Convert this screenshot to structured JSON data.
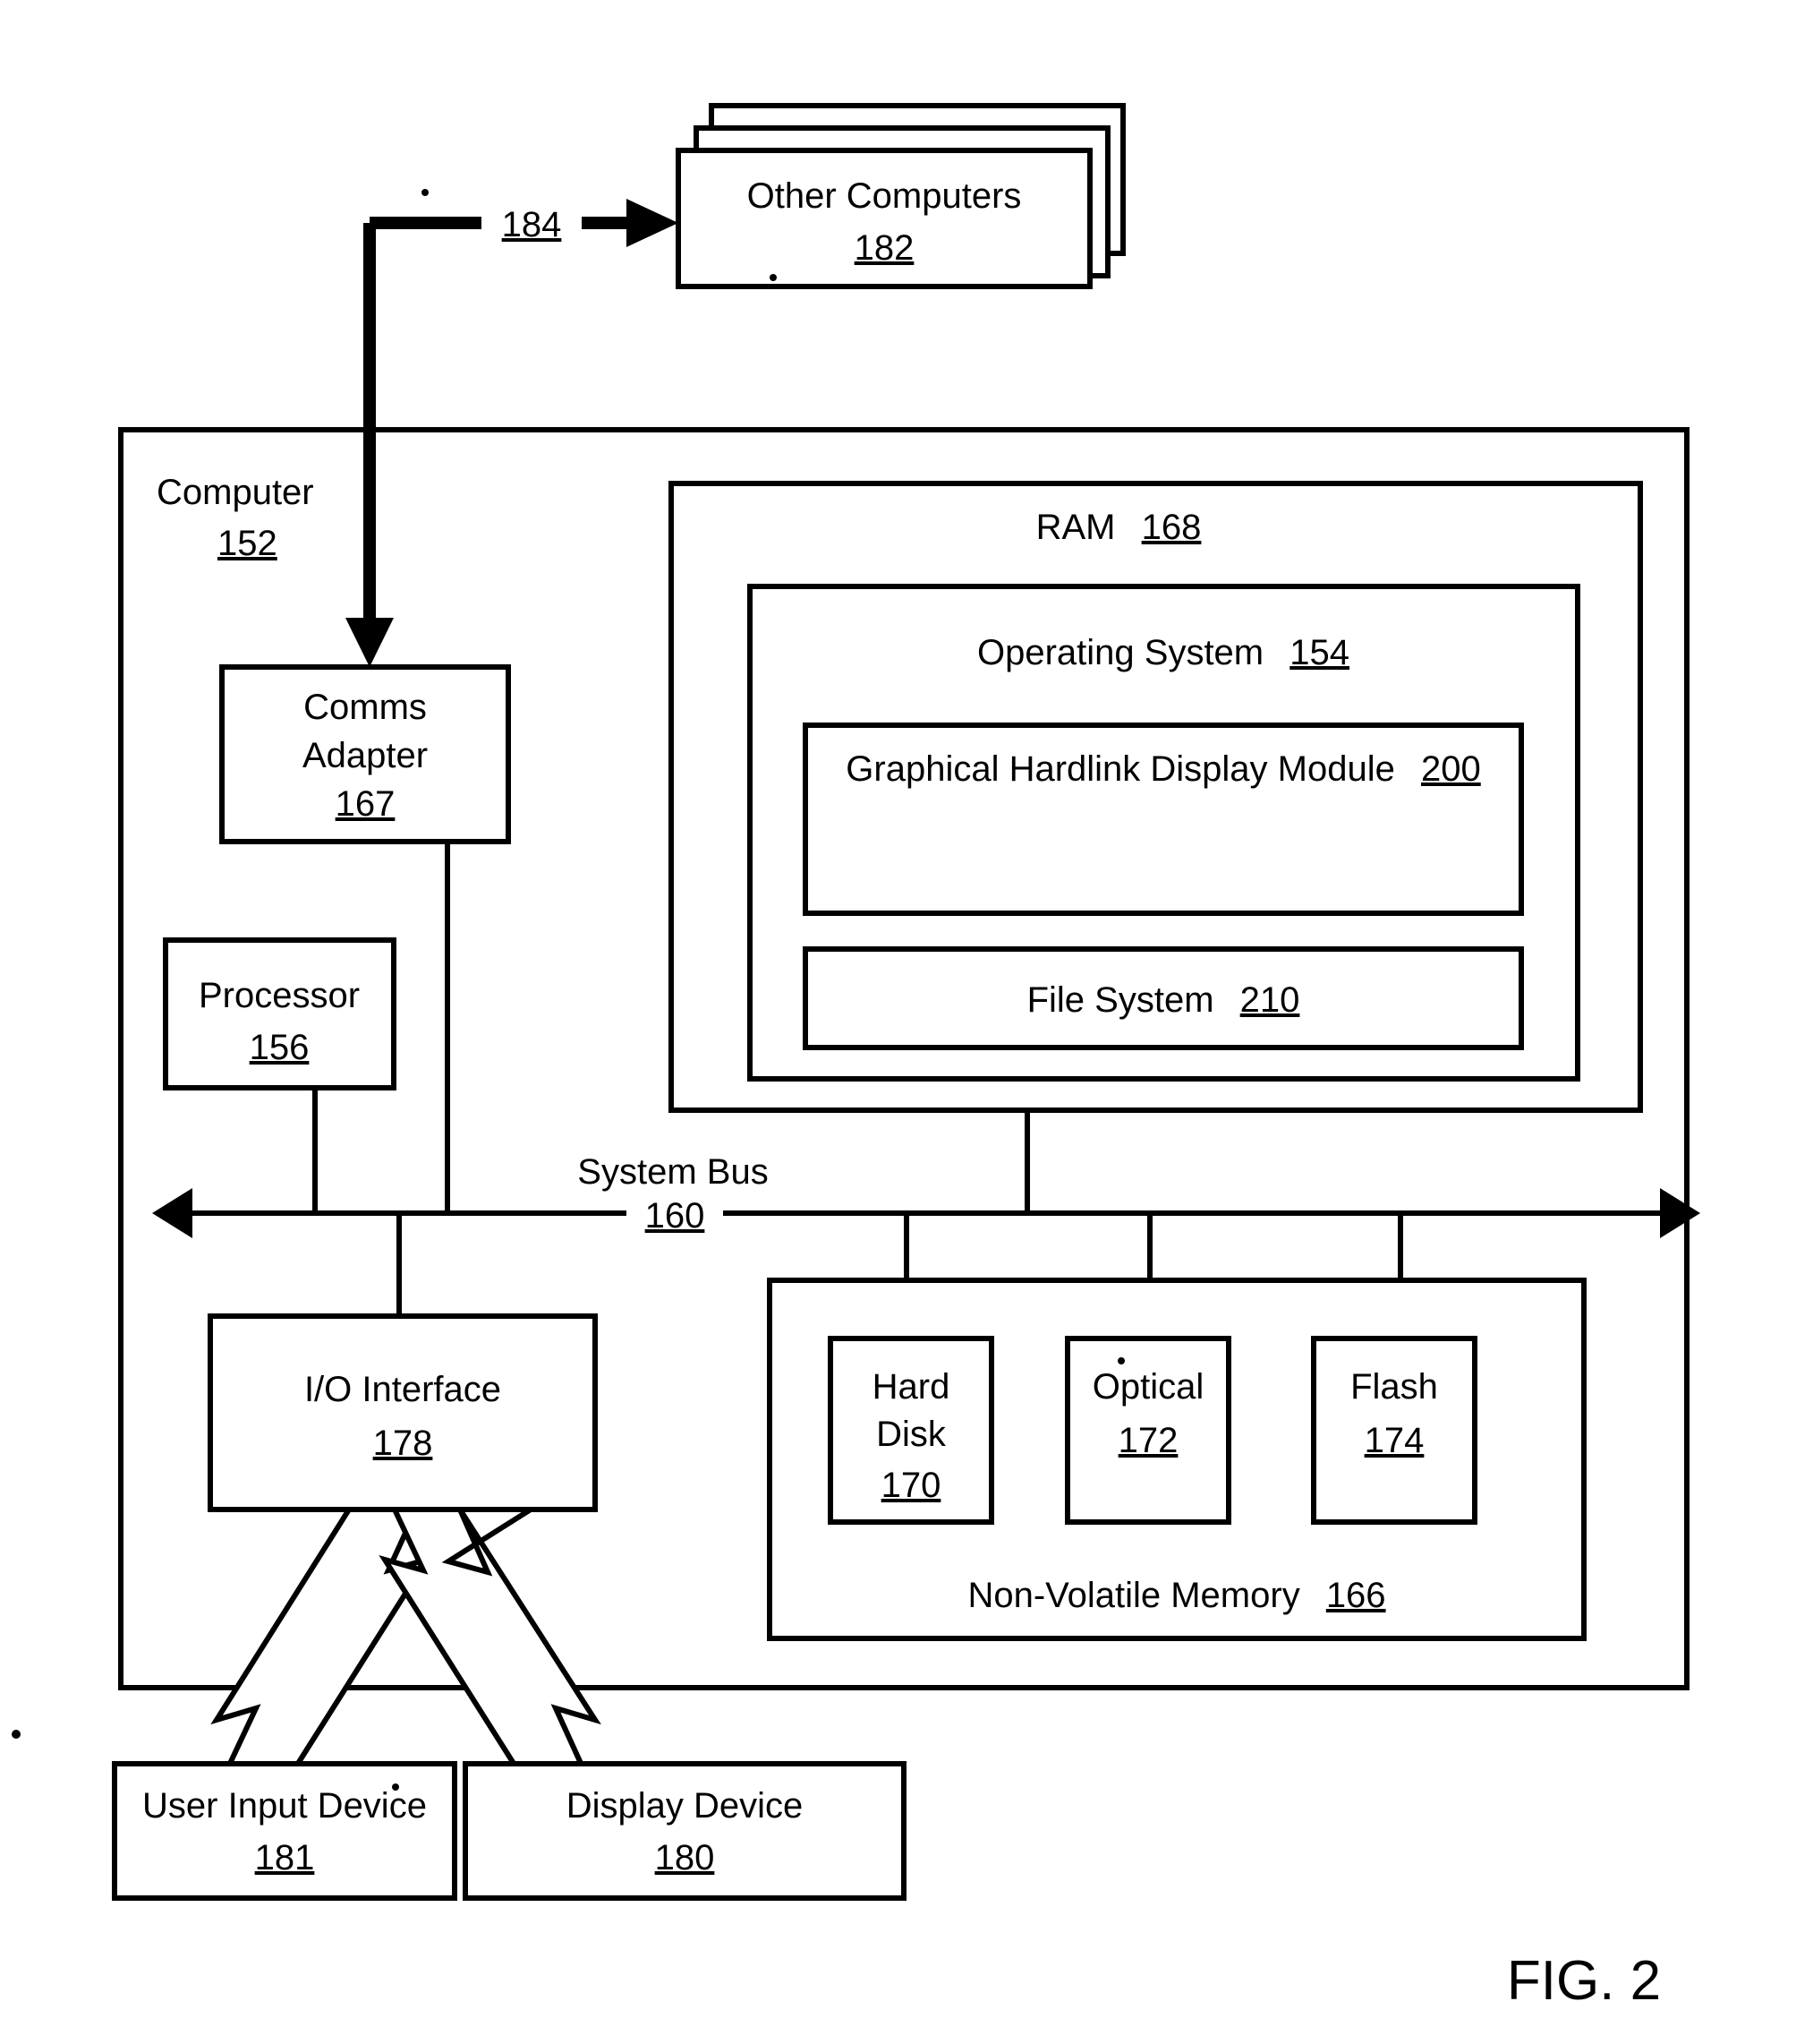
{
  "figure": {
    "label": "FIG. 2",
    "title": "Computer architecture block diagram"
  },
  "nodes": {
    "other_computers": {
      "label": "Other Computers",
      "ref": "182"
    },
    "network_link": {
      "ref": "184"
    },
    "computer": {
      "label": "Computer",
      "ref": "152"
    },
    "comms_adapter": {
      "label_line1": "Comms",
      "label_line2": "Adapter",
      "ref": "167"
    },
    "processor": {
      "label": "Processor",
      "ref": "156"
    },
    "ram": {
      "label": "RAM",
      "ref": "168"
    },
    "operating_system": {
      "label": "Operating System",
      "ref": "154"
    },
    "hardlink_module": {
      "label": "Graphical Hardlink Display Module",
      "ref": "200"
    },
    "file_system": {
      "label": "File System",
      "ref": "210"
    },
    "system_bus": {
      "label": "System Bus",
      "ref": "160"
    },
    "io_interface": {
      "label": "I/O Interface",
      "ref": "178"
    },
    "nonvolatile_memory": {
      "label": "Non-Volatile Memory",
      "ref": "166"
    },
    "hard_disk": {
      "label_line1": "Hard",
      "label_line2": "Disk",
      "ref": "170"
    },
    "optical": {
      "label": "Optical",
      "ref": "172"
    },
    "flash": {
      "label": "Flash",
      "ref": "174"
    },
    "user_input_device": {
      "label": "User Input Device",
      "ref": "181"
    },
    "display_device": {
      "label": "Display Device",
      "ref": "180"
    }
  },
  "colors": {
    "ink": "#000000",
    "paper": "#ffffff"
  }
}
